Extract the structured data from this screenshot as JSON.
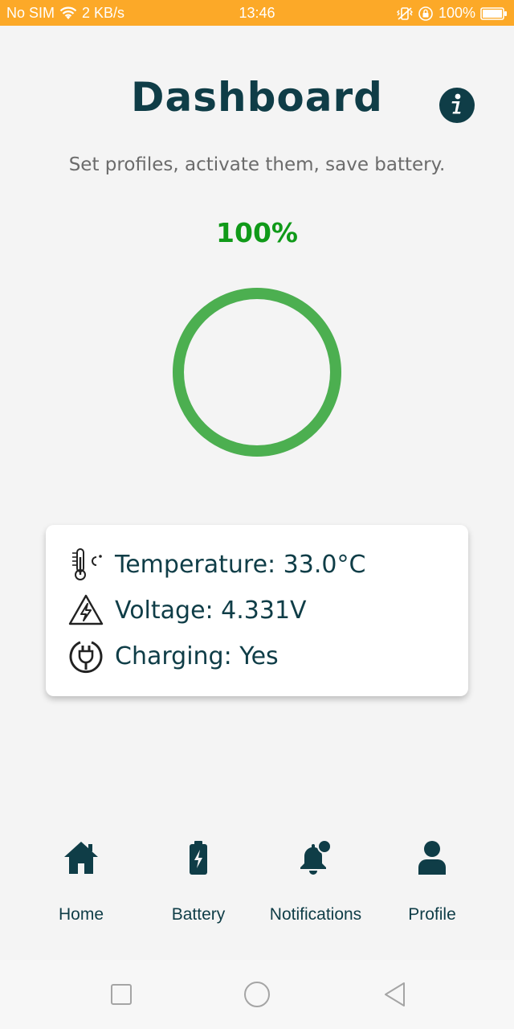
{
  "status_bar": {
    "carrier": "No SIM",
    "speed": "2 KB/s",
    "time": "13:46",
    "battery": "100%",
    "background_color": "#fca928"
  },
  "header": {
    "title": "Dashboard",
    "subtitle": "Set profiles, activate them, save battery.",
    "info_icon": "info-icon"
  },
  "battery": {
    "percent_label": "100%",
    "level": 1.0,
    "ring_color": "#4caf50",
    "percent_color": "#109a19"
  },
  "stats": {
    "temperature": "Temperature: 33.0°C",
    "voltage": "Voltage: 4.331V",
    "charging": "Charging: Yes"
  },
  "nav": {
    "items": [
      {
        "label": "Home",
        "icon": "home-icon"
      },
      {
        "label": "Battery",
        "icon": "battery-icon"
      },
      {
        "label": "Notifications",
        "icon": "bell-icon"
      },
      {
        "label": "Profile",
        "icon": "user-icon"
      }
    ]
  },
  "system_nav": {
    "recents": "square-icon",
    "home": "circle-icon",
    "back": "triangle-back-icon"
  },
  "colors": {
    "primary": "#0f3d47",
    "background": "#f4f4f4"
  }
}
